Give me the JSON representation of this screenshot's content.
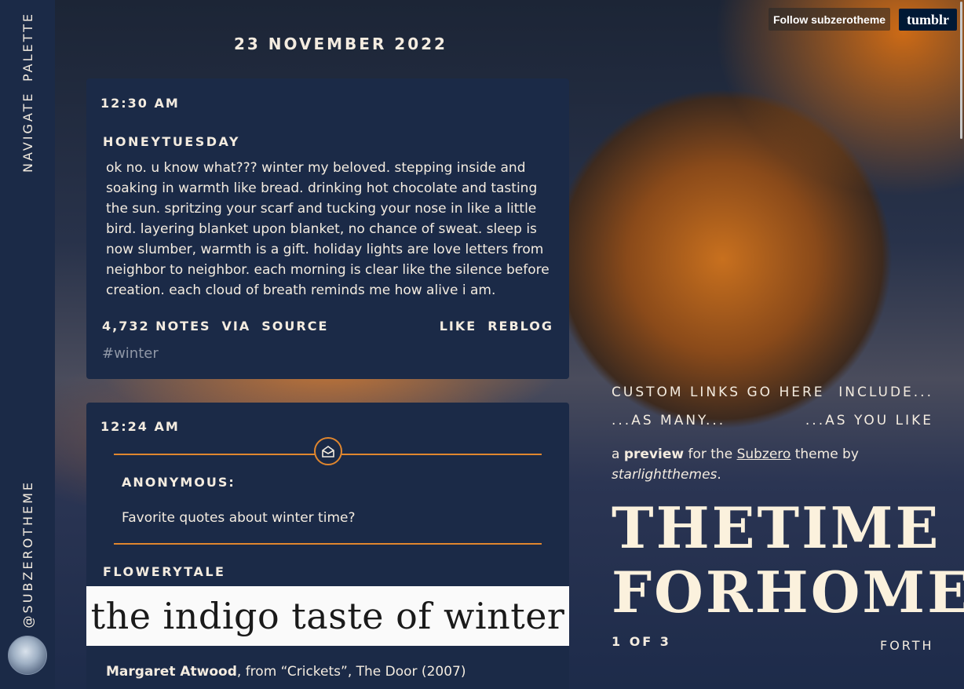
{
  "sidebar": {
    "nav": [
      "NAVIGATE",
      "PALETTE"
    ],
    "handle": "@SUBZEROTHEME"
  },
  "top_bar": {
    "follow_label": "Follow subzerotheme",
    "brand": "tumblr"
  },
  "date": "23 NOVEMBER 2022",
  "post1": {
    "time": "12:30 AM",
    "user": "HONEYTUESDAY",
    "body": "ok no. u know what??? winter my beloved. stepping inside and soaking in warmth like bread. drinking hot chocolate and tasting the sun. spritzing your scarf and tucking your nose in like a little bird. layering blanket upon blanket, no chance of sweat. sleep is now slumber, warmth is a gift. holiday lights are love letters from neighbor to neighbor. each morning is clear like the silence before creation. each cloud of breath reminds me how alive i am.",
    "notes": "4,732 NOTES",
    "via": "VIA",
    "source": "SOURCE",
    "like": "LIKE",
    "reblog": "REBLOG",
    "tag": "#winter"
  },
  "post2": {
    "time": "12:24 AM",
    "ask_name": "ANONYMOUS:",
    "ask_question": "Favorite quotes about winter time?",
    "user": "FLOWERYTALE",
    "quote_image_text": "the indigo taste of winter",
    "quote_author": "Margaret Atwood",
    "quote_source": ", from “Crickets”, The Door (2007)"
  },
  "right": {
    "links_row1": [
      "CUSTOM LINKS GO HERE",
      "INCLUDE..."
    ],
    "links_row2": [
      "...AS MANY...",
      "...AS YOU LIKE"
    ],
    "desc_a": "a",
    "desc_preview": "preview",
    "desc_mid": "for the",
    "desc_theme": "Subzero",
    "desc_by": "theme by",
    "desc_author": "starlightthemes",
    "desc_end": ".",
    "title_line1": [
      "THE",
      "TIME"
    ],
    "title_line2": [
      "FOR",
      "HOME"
    ],
    "pager": "1 OF 3",
    "forth": "FORTH"
  },
  "colors": {
    "panel": "#1b2a47",
    "accent": "#e0862e",
    "text": "#f4ece0"
  }
}
